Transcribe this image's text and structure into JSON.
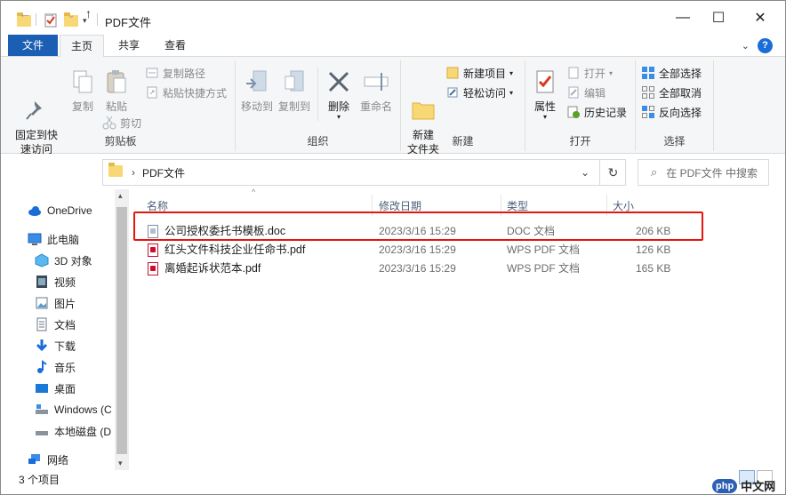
{
  "window": {
    "title": "PDF文件",
    "minimize": "—",
    "maximize": "☐",
    "close": "✕"
  },
  "ribbon_tabs": [
    "文件",
    "主页",
    "共享",
    "查看"
  ],
  "ribbon": {
    "clipboard": {
      "label": "剪贴板",
      "pin": "固定到快\n速访问",
      "copy": "复制",
      "paste": "粘贴",
      "copy_path": "复制路径",
      "paste_shortcut": "粘贴快捷方式",
      "cut": "剪切"
    },
    "organize": {
      "label": "组织",
      "move_to": "移动到",
      "copy_to": "复制到",
      "delete": "删除",
      "rename": "重命名"
    },
    "new": {
      "label": "新建",
      "new_folder": "新建\n文件夹",
      "new_item": "新建项目",
      "easy_access": "轻松访问"
    },
    "open": {
      "label": "打开",
      "properties": "属性",
      "open": "打开",
      "edit": "编辑",
      "history": "历史记录"
    },
    "select": {
      "label": "选择",
      "select_all": "全部选择",
      "select_none": "全部取消",
      "invert": "反向选择"
    }
  },
  "address": {
    "path": "PDF文件",
    "separator": "›",
    "search_placeholder": "在 PDF文件 中搜索"
  },
  "nav": [
    {
      "label": "OneDrive",
      "icon": "cloud-icon"
    },
    {
      "label": "此电脑",
      "icon": "computer-icon"
    },
    {
      "label": "3D 对象",
      "icon": "cube-icon"
    },
    {
      "label": "视频",
      "icon": "video-icon"
    },
    {
      "label": "图片",
      "icon": "picture-icon"
    },
    {
      "label": "文档",
      "icon": "document-icon"
    },
    {
      "label": "下载",
      "icon": "download-icon"
    },
    {
      "label": "音乐",
      "icon": "music-icon"
    },
    {
      "label": "桌面",
      "icon": "desktop-icon"
    },
    {
      "label": "Windows (C",
      "icon": "drive-icon"
    },
    {
      "label": "本地磁盘 (D",
      "icon": "drive-icon"
    },
    {
      "label": "网络",
      "icon": "network-icon"
    }
  ],
  "columns": {
    "name": "名称",
    "date": "修改日期",
    "type": "类型",
    "size": "大小"
  },
  "files": [
    {
      "name": "公司授权委托书模板.doc",
      "date": "2023/3/16 15:29",
      "type": "DOC 文档",
      "size": "206 KB",
      "icon": "doc-file-icon"
    },
    {
      "name": "红头文件科技企业任命书.pdf",
      "date": "2023/3/16 15:29",
      "type": "WPS PDF 文档",
      "size": "126 KB",
      "icon": "pdf-file-icon"
    },
    {
      "name": "离婚起诉状范本.pdf",
      "date": "2023/3/16 15:29",
      "type": "WPS PDF 文档",
      "size": "165 KB",
      "icon": "pdf-file-icon"
    }
  ],
  "status": {
    "count": "3 个项目"
  },
  "watermark": {
    "logo": "php",
    "text": "中文网"
  },
  "colors": {
    "file_tab": "#1a5fb4",
    "highlight": "#e3170d",
    "column_header": "#4c607a"
  }
}
